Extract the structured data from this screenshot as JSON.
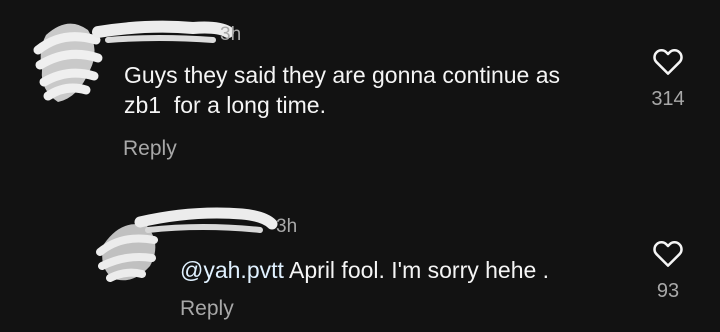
{
  "comments": [
    {
      "time": "3h",
      "text": "Guys they said they are gonna continue as\nzb1  for a long time.",
      "reply_label": "Reply",
      "like_count": "314",
      "icons": {
        "like": "heart-outline-icon"
      }
    },
    {
      "time": "3h",
      "mention": "@yah.pvtt",
      "text": " April fool. I'm sorry hehe .",
      "reply_label": "Reply",
      "like_count": "93",
      "icons": {
        "like": "heart-outline-icon"
      }
    }
  ],
  "colors": {
    "background": "#121212",
    "text_primary": "#f5f5f5",
    "text_secondary": "#a8a8a8",
    "redaction": "#e8e8e8"
  }
}
